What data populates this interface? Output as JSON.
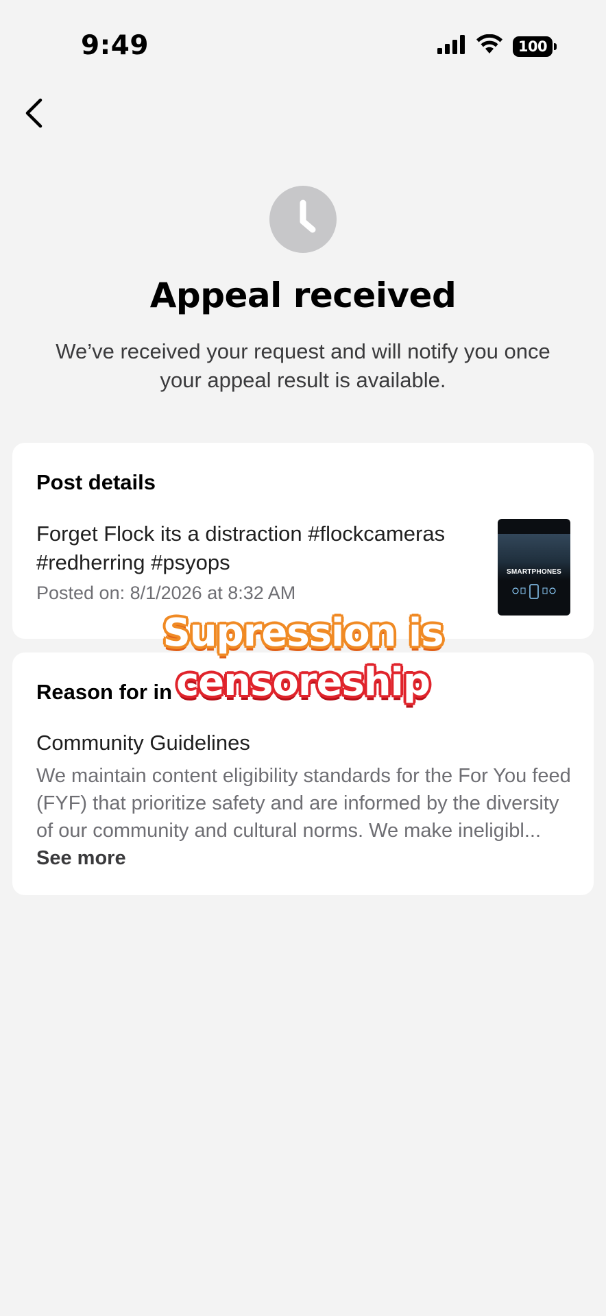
{
  "status_bar": {
    "time": "9:49",
    "battery": "100",
    "signal_icon": "cellular-signal-icon",
    "wifi_icon": "wifi-icon"
  },
  "nav": {
    "back_icon": "chevron-left-icon"
  },
  "header": {
    "icon": "clock-icon",
    "title": "Appeal received",
    "subtitle": "We’ve received your request and will notify you once your appeal result is available."
  },
  "post_details": {
    "heading": "Post details",
    "text": "Forget Flock its a distraction #flockcameras #redherring #psyops",
    "posted_on": "Posted on: 8/1/2026 at 8:32 AM",
    "thumbnail_label": "SMARTPHONES"
  },
  "reason": {
    "heading": "Reason for in",
    "title": "Community Guidelines",
    "description": "We maintain content eligibility standards for the For You feed (FYF) that prioritize safety and are informed by the diversity of our community and cultural norms. We make ineligibl...",
    "see_more": "See more"
  },
  "overlay_caption": {
    "line1": "Supression is",
    "line2": "censoreship"
  },
  "colors": {
    "background": "#f3f3f3",
    "card": "#ffffff",
    "clock_circle": "#c7c7c9",
    "caption_orange": "#f08a24",
    "caption_red": "#e0242c"
  }
}
